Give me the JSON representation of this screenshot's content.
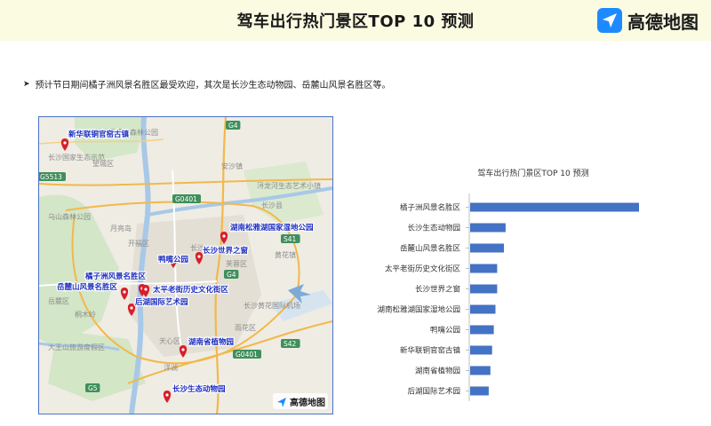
{
  "header": {
    "title": "驾车出行热门景区TOP 10 预测",
    "logo_text": "高德地图"
  },
  "summary": "预计节日期间橘子洲风景名胜区最受欢迎，其次是长沙生态动物园、岳麓山风景名胜区等。",
  "map": {
    "watermark": "高德地图",
    "road_labels": [
      "G5513",
      "G4",
      "G0401",
      "G4",
      "S41",
      "S42",
      "G0401",
      "G5"
    ],
    "place_labels": [
      "长沙黑麋峰森林公园",
      "长沙国家生态示范",
      "乌山森林公园",
      "月亮岛",
      "开福区",
      "安沙镇",
      "浔龙河生态艺术小镇",
      "长沙县",
      "黄花镇",
      "芙蓉区",
      "长沙黄花国际机场",
      "岳麓区",
      "天心区",
      "雨花区",
      "大王山旅游度假区",
      "长沙",
      "洋湖",
      "桐木岭",
      "望城区"
    ],
    "pins": [
      {
        "name": "新华联铜官窑古镇"
      },
      {
        "name": "湖南松雅湖国家湿地公园"
      },
      {
        "name": "长沙世界之窗"
      },
      {
        "name": "鸭嘴公园"
      },
      {
        "name": "橘子洲风景名胜区"
      },
      {
        "name": "岳麓山风景名胜区"
      },
      {
        "name": "太平老街历史文化街区"
      },
      {
        "name": "后湖国际艺术园"
      },
      {
        "name": "湖南省植物园"
      },
      {
        "name": "长沙生态动物园"
      }
    ]
  },
  "chart_data": {
    "type": "bar",
    "orientation": "horizontal",
    "title": "驾车出行热门景区TOP 10 预测",
    "categories": [
      "橘子洲风景名胜区",
      "长沙生态动物园",
      "岳麓山风景名胜区",
      "太平老街历史文化街区",
      "长沙世界之窗",
      "湖南松雅湖国家湿地公园",
      "鸭嘴公园",
      "新华联铜官窑古镇",
      "湖南省植物园",
      "后湖国际艺术园"
    ],
    "values": [
      100,
      21,
      20,
      16,
      16,
      15,
      14,
      13,
      12,
      11
    ],
    "xlim": [
      0,
      100
    ],
    "grid": false,
    "color": "#4472c4"
  },
  "colors": {
    "header_bg": "#fbfbe2",
    "pin": "#d81e2b",
    "pin_label": "#1f2fbf",
    "map_frame": "#4a72c8",
    "logo_blue": "#1d8bff"
  }
}
